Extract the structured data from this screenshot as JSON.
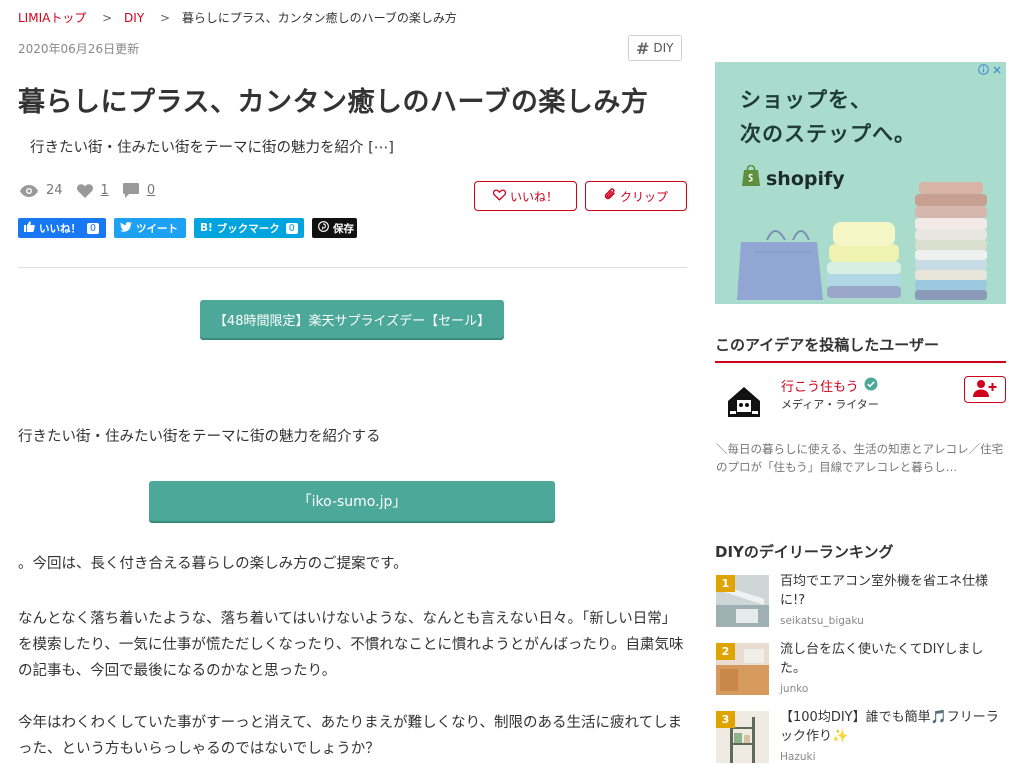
{
  "breadcrumb": {
    "home": "LIMIAトップ",
    "category": "DIY",
    "current": "暮らしにプラス、カンタン癒しのハーブの楽しみ方",
    "separator": ">"
  },
  "article": {
    "updated": "2020年06月26日更新",
    "tag": "DIY",
    "title": "暮らしにプラス、カンタン癒しのハーブの楽しみ方",
    "lead": "行きたい街・住みたい街をテーマに街の魅力を紹介 [⋯]",
    "stats": {
      "views": "24",
      "likes": "1",
      "comments": "0"
    },
    "like_button": "いいね！",
    "clip_button": "クリップ"
  },
  "share": {
    "facebook_label": "いいね！",
    "facebook_count": "0",
    "twitter_label": "ツイート",
    "hatena_label": "ブックマーク",
    "hatena_prefix": "B!",
    "hatena_count": "0",
    "pinterest_label": "保存"
  },
  "body": {
    "rakuten_button": "【48時間限定】楽天サプライズデー【セール】",
    "intro": "行きたい街・住みたい街をテーマに街の魅力を紹介する",
    "source_button": "「iko-sumo.jp」",
    "p1": "。今回は、長く付き合える暮らしの楽しみ方のご提案です。",
    "p2": "なんとなく落ち着いたような、落ち着いてはいけないような、なんとも言えない日々。「新しい日常」を模索したり、一気に仕事が慌ただしくなったり、不慣れなことに慣れようとがんばったり。自粛気味の記事も、今回で最後になるのかなと思ったり。",
    "p3": "今年はわくわくしていた事がすーっと消えて、あたりまえが難しくなり、制限のある生活に疲れてしまった、という方もいらっしゃるのではないでしょうか？"
  },
  "ad": {
    "line1": "ショップを、",
    "line2": "次のステップへ。",
    "brand": "shopify",
    "colors": {
      "bg": "#a9dccd"
    }
  },
  "sidebar": {
    "user_section_title": "このアイデアを投稿したユーザー",
    "user_name": "行こう住もう",
    "user_role": "メディア・ライター",
    "user_desc": "＼毎日の暮らしに使える、生活の知恵とアレコレ／住宅のプロが「住もう」目線でアレコレと暮らし…",
    "ranking_title": "DIYのデイリーランキング",
    "ranking": [
      {
        "rank": "1",
        "title": "百均でエアコン室外機を省エネ仕様に!?",
        "author": "seikatsu_bigaku"
      },
      {
        "rank": "2",
        "title": "流し台を広く使いたくてDIYしました。",
        "author": "junko"
      },
      {
        "rank": "3",
        "title": "【100均DIY】誰でも簡単🎵フリーラック作り✨",
        "author": "Hazuki"
      }
    ]
  },
  "colors": {
    "accent": "#d0021b",
    "teal": "#4ca898"
  }
}
